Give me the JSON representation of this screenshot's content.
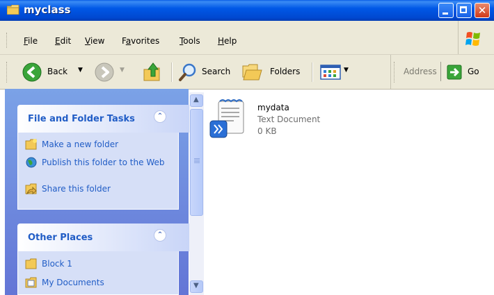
{
  "window": {
    "title": "myclass"
  },
  "menu": {
    "items": [
      {
        "pre": "",
        "key": "F",
        "post": "ile"
      },
      {
        "pre": "",
        "key": "E",
        "post": "dit"
      },
      {
        "pre": "",
        "key": "V",
        "post": "iew"
      },
      {
        "pre": "F",
        "key": "a",
        "post": "vorites"
      },
      {
        "pre": "",
        "key": "T",
        "post": "ools"
      },
      {
        "pre": "",
        "key": "H",
        "post": "elp"
      }
    ]
  },
  "toolbar": {
    "back_label": "Back",
    "search_label": "Search",
    "folders_label": "Folders",
    "address_label": "Address",
    "go_label": "Go"
  },
  "tasks_panel": {
    "title": "File and Folder Tasks",
    "items": [
      "Make a new folder",
      "Publish this folder to the Web",
      "Share this folder"
    ]
  },
  "places_panel": {
    "title": "Other Places",
    "items": [
      "Block 1",
      "My Documents"
    ]
  },
  "files": [
    {
      "name": "mydata",
      "type": "Text Document",
      "size": "0 KB"
    }
  ],
  "icons": [
    "folder-icon",
    "back-icon",
    "forward-icon",
    "up-folder-icon",
    "search-icon",
    "folders-icon",
    "views-icon",
    "go-icon",
    "windows-logo-icon",
    "collapse-icon",
    "new-folder-icon",
    "publish-icon",
    "share-icon",
    "text-file-icon",
    "shortcut-arrow-icon",
    "scroll-up-icon",
    "scroll-down-icon"
  ],
  "colors": {
    "titlebar": "#0058e6",
    "task_link": "#215dc6",
    "pane_bg": "#7ba2e7",
    "menubar": "#ece9d8"
  }
}
